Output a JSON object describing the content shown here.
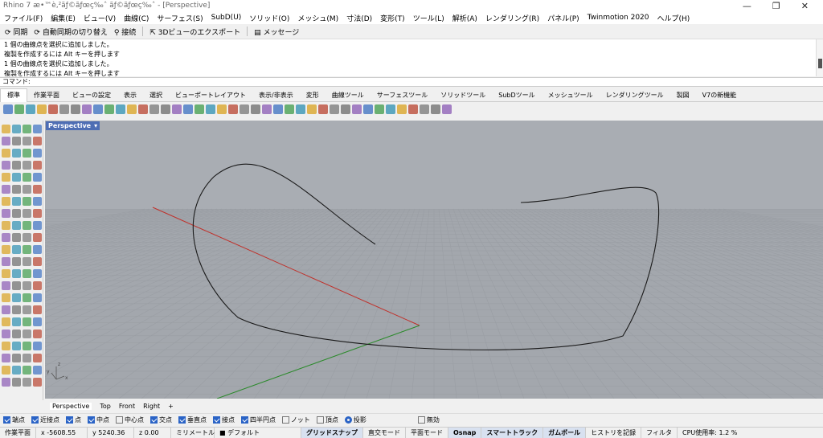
{
  "window": {
    "title": "Rhino 7 æ•™è‚²ãƒ©ãƒœç‰ˆ ãƒ©ãƒœç‰ˆ - [Perspective]",
    "controls": [
      "—",
      "❐",
      "✕"
    ]
  },
  "menu": [
    "ファイル(F)",
    "編集(E)",
    "ビュー(V)",
    "曲線(C)",
    "サーフェス(S)",
    "SubD(U)",
    "ソリッド(O)",
    "メッシュ(M)",
    "寸法(D)",
    "変形(T)",
    "ツール(L)",
    "解析(A)",
    "レンダリング(R)",
    "パネル(P)",
    "Twinmotion 2020",
    "ヘルプ(H)"
  ],
  "maintoolbar": {
    "sync": "同期",
    "autosync": "自動同期の切り替え",
    "connect": "接続",
    "export3d": "3Dビューのエクスポート",
    "message": "メッセージ"
  },
  "history": [
    "1 個の曲線点を選択に追加しました。",
    "複製を作成するには Alt キーを押します",
    "1 個の曲線点を選択に追加しました。",
    "複製を作成するには Alt キーを押します"
  ],
  "command": {
    "label": "コマンド:"
  },
  "tabs": [
    "標準",
    "作業平面",
    "ビューの設定",
    "表示",
    "選択",
    "ビューポートレイアウト",
    "表示/非表示",
    "変形",
    "曲線ツール",
    "サーフェスツール",
    "ソリッドツール",
    "SubDツール",
    "メッシュツール",
    "レンダリングツール",
    "製図",
    "V7の新機能"
  ],
  "viewport": {
    "name": "Perspective",
    "dropdown": "▾",
    "axis_x": "x",
    "axis_y": "y",
    "axis_z": "z"
  },
  "viewport_tabs": [
    "Perspective",
    "Top",
    "Front",
    "Right",
    "+"
  ],
  "osnaps": [
    {
      "label": "端点",
      "on": true
    },
    {
      "label": "近接点",
      "on": true
    },
    {
      "label": "点",
      "on": true
    },
    {
      "label": "中点",
      "on": true
    },
    {
      "label": "中心点",
      "on": false
    },
    {
      "label": "交点",
      "on": true
    },
    {
      "label": "垂直点",
      "on": true
    },
    {
      "label": "接点",
      "on": true
    },
    {
      "label": "四半円点",
      "on": true
    },
    {
      "label": "ノット",
      "on": false
    },
    {
      "label": "頂点",
      "on": false
    }
  ],
  "osnap_project": "投影",
  "osnap_disable": "無効",
  "status": {
    "cplane": "作業平面",
    "x": "x -5608.55",
    "y": "y 5240.36",
    "z": "z 0.00",
    "units": "ミリメートル",
    "layer": "デフォルト",
    "grid_snap": "グリッドスナップ",
    "ortho": "直交モード",
    "planar": "平面モード",
    "osnap": "Osnap",
    "smarttrack": "スマートトラック",
    "gumball": "ガムボール",
    "history": "ヒストリを記録",
    "filter": "フィルタ",
    "cpu": "CPU使用率: 1.2 %"
  },
  "colors": {
    "viewport_bg": "#a9adb3",
    "grid": "#9a9ea4",
    "x_axis": "#c0302a",
    "y_axis": "#2b8a2b",
    "curve": "#1a1a1a",
    "viewport_label": "#4e6eb4"
  }
}
